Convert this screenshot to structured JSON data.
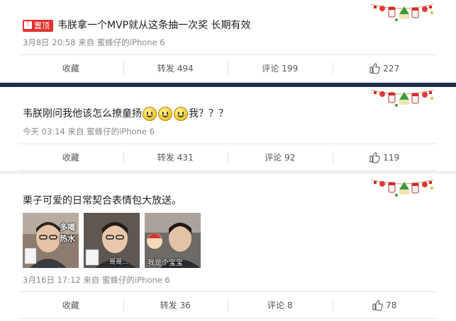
{
  "colors": {
    "pin_badge": "#e4322e",
    "divider": "#202c48",
    "meta_text": "#888888"
  },
  "posts": [
    {
      "pinned_label": "置顶",
      "text": "韦朕拿一个MVP就从这条抽一次奖 长期有效",
      "meta": "3月8日 20:58 来自 蜜蜂仔的iPhone 6",
      "actions": {
        "collect_label": "收藏",
        "repost_label": "转发",
        "repost_count": "494",
        "comment_label": "评论",
        "comment_count": "199",
        "like_count": "227"
      }
    },
    {
      "text_before": "韦朕刚问我他该怎么撩童扬",
      "emoji_icon": "smiley-face-icon",
      "emoji_count": 3,
      "text_after": "我？？？",
      "meta": "今天 03:14 来自 蜜蜂仔的iPhone 6",
      "actions": {
        "collect_label": "收藏",
        "repost_label": "转发",
        "repost_count": "431",
        "comment_label": "评论",
        "comment_count": "92",
        "like_count": "119"
      }
    },
    {
      "text": "栗子可爱的日常契合表情包大放送。",
      "photos": [
        {
          "caption_top": "多喝",
          "caption_mid": "热水"
        },
        {
          "caption_bottom": "哥哥..."
        },
        {
          "caption_bottom": "我是个宝宝"
        }
      ],
      "meta": "3月16日 17:12 来自 蜜蜂仔的iPhone 6",
      "actions": {
        "collect_label": "收藏",
        "repost_label": "转发",
        "repost_count": "36",
        "comment_label": "评论",
        "comment_count": "8",
        "like_count": "78"
      }
    }
  ]
}
